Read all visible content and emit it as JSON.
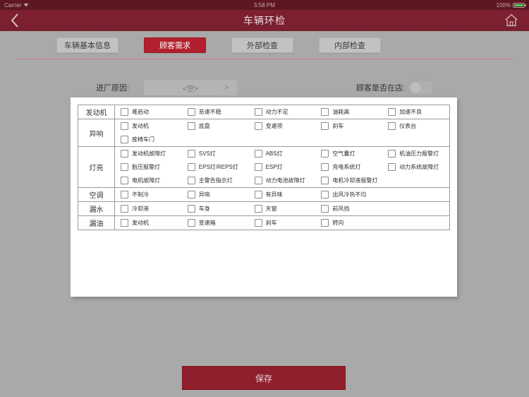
{
  "statusbar": {
    "carrier": "Carrier",
    "time": "5:58 PM",
    "battery": "100%"
  },
  "navbar": {
    "title": "车辆环检",
    "back_icon": "chevron-left-icon",
    "home_icon": "home-icon"
  },
  "tabs": [
    {
      "label": "车辆基本信息",
      "active": false
    },
    {
      "label": "顾客需求",
      "active": true
    },
    {
      "label": "外部检查",
      "active": false
    },
    {
      "label": "内部检查",
      "active": false
    }
  ],
  "form": {
    "reason_label": "进厂原因:",
    "reason_value": "<空>",
    "reason_chevron": ">",
    "instore_label": "顾客是否在店:",
    "instore_on": false
  },
  "table": {
    "rows": [
      {
        "label": "发动机",
        "items": [
          "难启动",
          "怠速不稳",
          "动力不足",
          "油耗高",
          "加速不良"
        ]
      },
      {
        "label": "异响",
        "items": [
          "发动机",
          "底盘",
          "变速项",
          "刹车",
          "仪表台",
          "座椅车门"
        ]
      },
      {
        "label": "灯亮",
        "items": [
          "发动机故障灯",
          "SVS灯",
          "ABS灯",
          "空气囊灯",
          "机油压力报警灯",
          "胎压报警灯",
          "EPS灯/REPS灯",
          "ESP灯",
          "充电系统灯",
          "动力系统故障灯",
          "电机故障灯",
          "主警告指示灯",
          "动力电池故障灯",
          "电机冷却液报警灯"
        ]
      },
      {
        "label": "空调",
        "items": [
          "不制冷",
          "异响",
          "有异味",
          "出风冷热不均"
        ]
      },
      {
        "label": "漏水",
        "items": [
          "冷却液",
          "车身",
          "天窗",
          "前风挡"
        ]
      },
      {
        "label": "漏油",
        "items": [
          "发动机",
          "变速箱",
          "刹车",
          "转向"
        ]
      }
    ]
  },
  "save": {
    "label": "保存"
  },
  "colors": {
    "brand": "#7d1f2d",
    "accent": "#b21f2d",
    "save": "#8f1f2c",
    "page_bg": "#a9a9a9"
  }
}
